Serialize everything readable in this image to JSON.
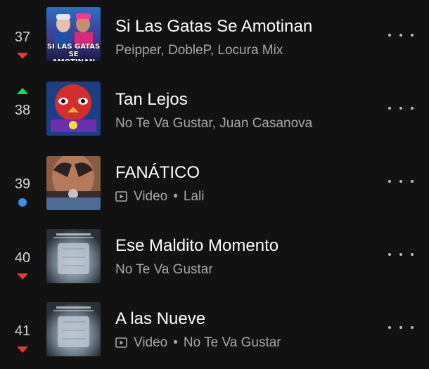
{
  "tracks": [
    {
      "rank": "37",
      "trend": "down",
      "title": "Si Las Gatas Se Amotinan",
      "subtitle": "Peipper, DobleP, Locura Mix",
      "cover_text": "SI LAS GATAS SE AMOTINAN"
    },
    {
      "rank": "38",
      "trend": "up",
      "title": "Tan Lejos",
      "subtitle": "No Te Va Gustar, Juan Casanova"
    },
    {
      "rank": "39",
      "trend": "new",
      "title": "FANÁTICO",
      "type_label": "Video",
      "separator": "•",
      "artist": "Lali"
    },
    {
      "rank": "40",
      "trend": "down",
      "title": "Ese Maldito Momento",
      "subtitle": "No Te Va Gustar"
    },
    {
      "rank": "41",
      "trend": "down",
      "title": "A las Nueve",
      "type_label": "Video",
      "separator": "•",
      "artist": "No Te Va Gustar"
    }
  ],
  "colors": {
    "background": "#121212",
    "trend_down": "#e5393b",
    "trend_up": "#1ed760",
    "trend_new": "#3d91f4"
  }
}
